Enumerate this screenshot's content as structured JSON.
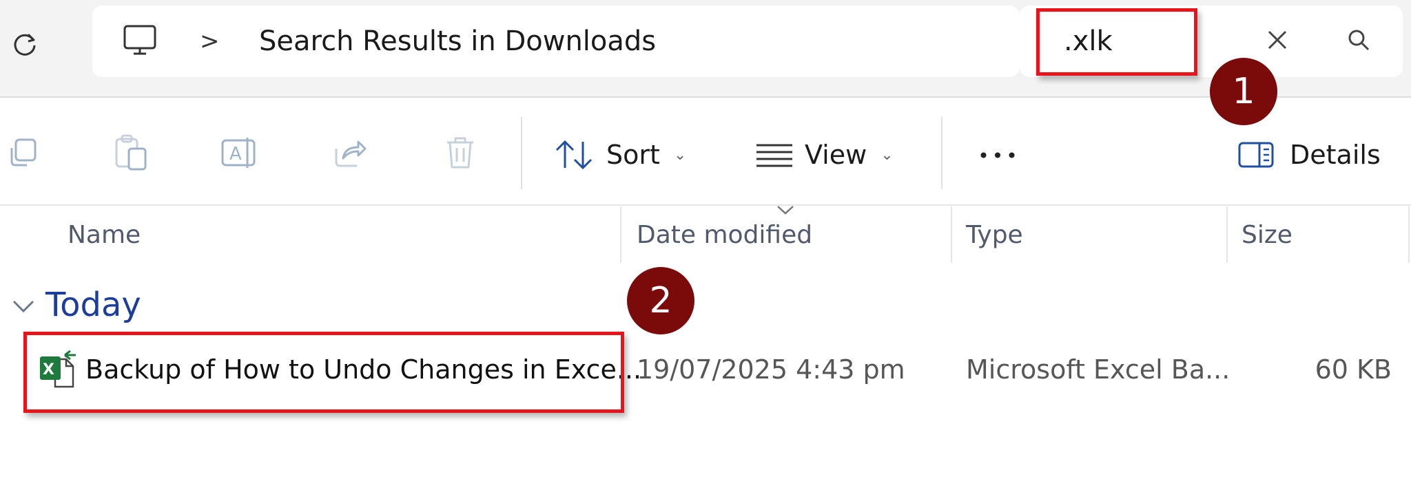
{
  "address_bar": {
    "breadcrumb_separator": ">",
    "location": "Search Results in Downloads"
  },
  "search": {
    "value": ".xlk"
  },
  "toolbar": {
    "sort_label": "Sort",
    "view_label": "View",
    "more_label": "•••",
    "details_label": "Details"
  },
  "columns": {
    "name": "Name",
    "date_modified": "Date modified",
    "type": "Type",
    "size": "Size"
  },
  "groups": [
    {
      "label": "Today",
      "files": [
        {
          "name": "Backup of How to Undo Changes in Exce...",
          "date_modified": "19/07/2025 4:43 pm",
          "type": "Microsoft Excel Ba...",
          "size": "60 KB",
          "icon": "excel-backup-file-icon"
        }
      ]
    }
  ],
  "annotations": {
    "step1": "1",
    "step2": "2",
    "highlight_color": "#e8141c",
    "badge_color": "#7b0a0a"
  },
  "colors": {
    "group_label": "#1c3e9a",
    "excel_green": "#1f7a3d"
  }
}
